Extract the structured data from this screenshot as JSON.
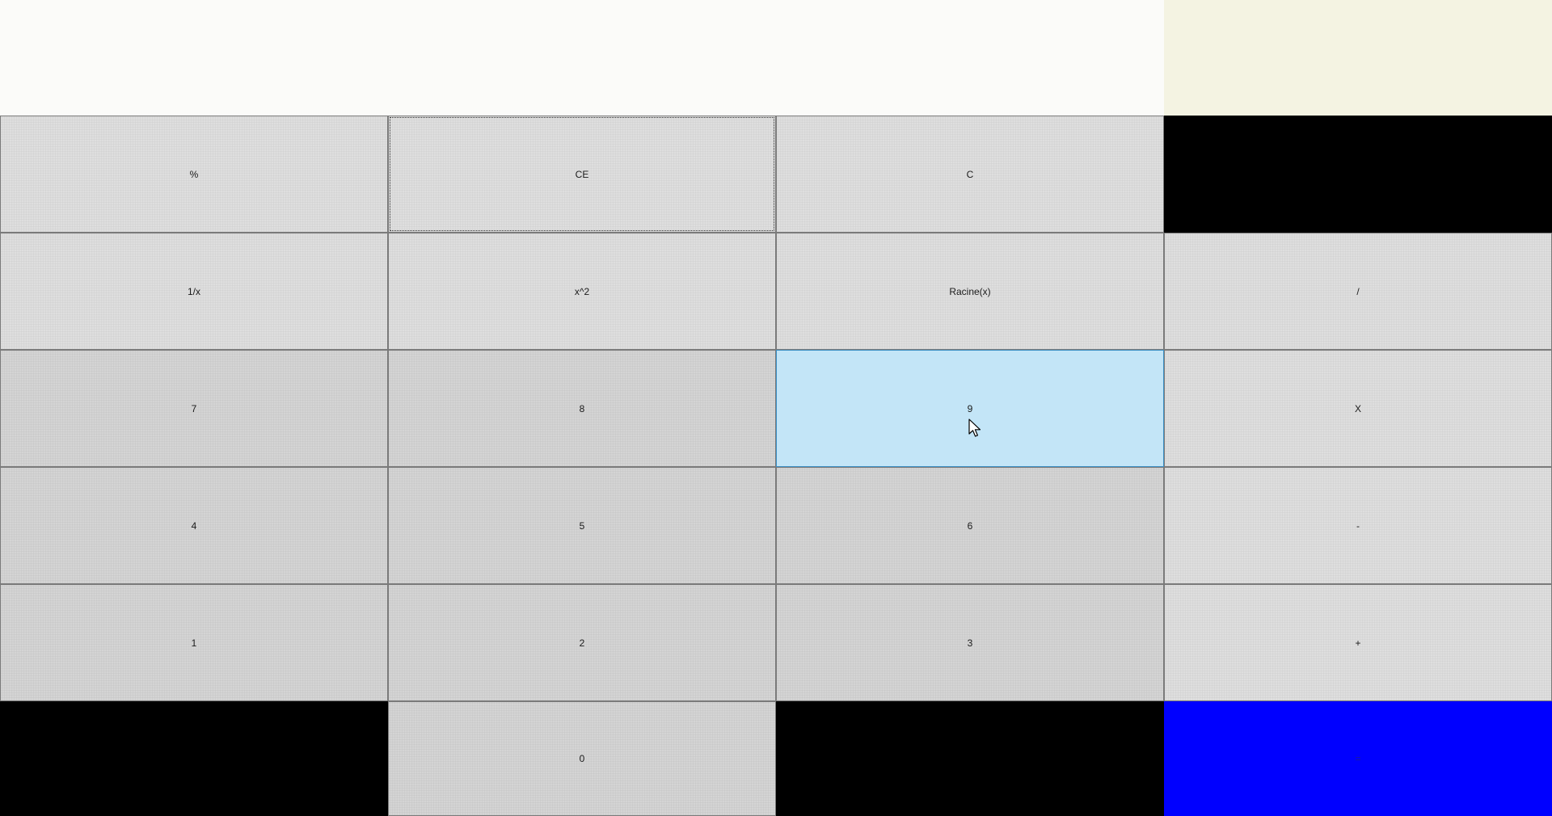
{
  "display": {
    "value": "",
    "history": ""
  },
  "keys": {
    "percent": "%",
    "ce": "CE",
    "c": "C",
    "backspace": "",
    "reciprocal": "1/x",
    "square": "x^2",
    "sqrt": "Racine(x)",
    "divide": "/",
    "seven": "7",
    "eight": "8",
    "nine": "9",
    "multiply": "X",
    "four": "4",
    "five": "5",
    "six": "6",
    "minus": "-",
    "one": "1",
    "two": "2",
    "three": "3",
    "plus": "+",
    "negate": "",
    "zero": "0",
    "decimal": "",
    "equals": "="
  },
  "state": {
    "focused_key": "CE",
    "hovered_key": "9"
  },
  "colors": {
    "display_bg": "#fbfbf9",
    "history_bg": "#f4f3e2",
    "key_bg": "#dddddd",
    "hover_bg": "#c3e5f7",
    "black_key": "#000000",
    "equals_bg": "#0000ff"
  },
  "icons": {
    "cursor": "mouse-pointer-icon"
  }
}
